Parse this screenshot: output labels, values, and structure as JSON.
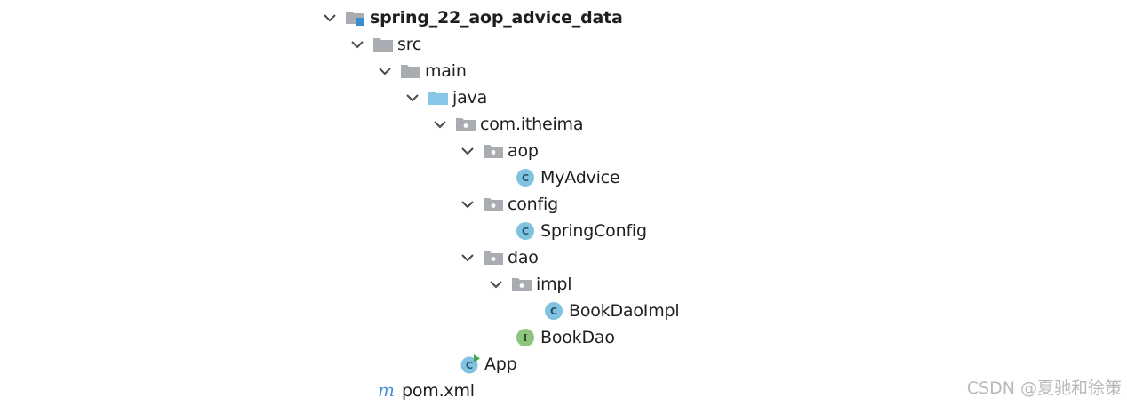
{
  "tree": [
    {
      "label": "spring_22_aop_advice_data",
      "icon": "module-folder-icon",
      "expanded": true,
      "bold": true
    },
    {
      "label": "src",
      "icon": "folder-icon",
      "expanded": true
    },
    {
      "label": "main",
      "icon": "folder-icon",
      "expanded": true
    },
    {
      "label": "java",
      "icon": "source-root-folder-icon",
      "expanded": true
    },
    {
      "label": "com.itheima",
      "icon": "package-icon",
      "expanded": true
    },
    {
      "label": "aop",
      "icon": "package-icon",
      "expanded": true
    },
    {
      "label": "MyAdvice",
      "icon": "class-icon"
    },
    {
      "label": "config",
      "icon": "package-icon",
      "expanded": true
    },
    {
      "label": "SpringConfig",
      "icon": "class-icon"
    },
    {
      "label": "dao",
      "icon": "package-icon",
      "expanded": true
    },
    {
      "label": "impl",
      "icon": "package-icon",
      "expanded": true
    },
    {
      "label": "BookDaoImpl",
      "icon": "class-icon"
    },
    {
      "label": "BookDao",
      "icon": "interface-icon"
    },
    {
      "label": "App",
      "icon": "runnable-class-icon"
    },
    {
      "label": "pom.xml",
      "icon": "maven-icon"
    }
  ],
  "watermark": "CSDN @夏驰和徐策",
  "colors": {
    "folder": "#a9adb2",
    "source_root": "#87c6e6",
    "class_badge": "#7fc3e0",
    "interface_badge": "#8fc47f",
    "maven": "#4b8fd6",
    "run_arrow": "#45a84a",
    "chevron": "#4a4a4a"
  }
}
